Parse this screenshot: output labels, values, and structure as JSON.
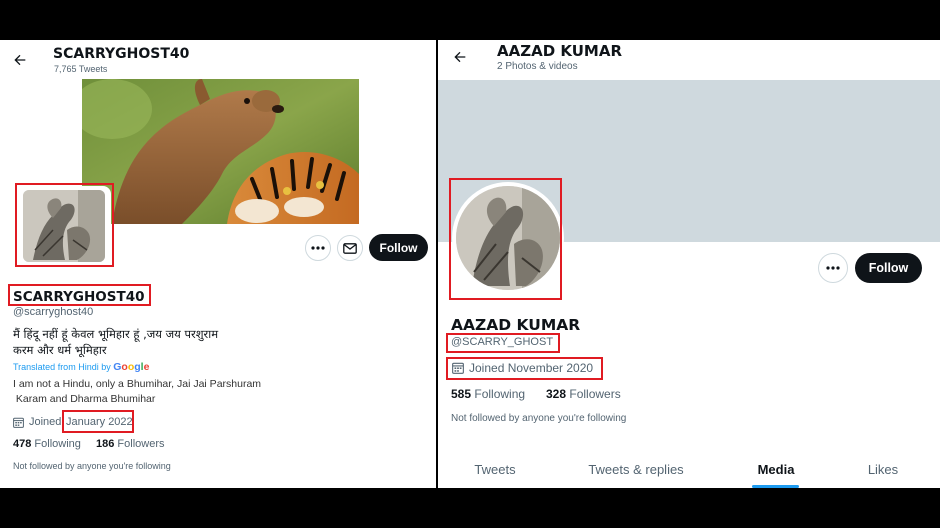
{
  "left": {
    "header": {
      "title": "SCARRYGHOST40",
      "subtitle": "7,765 Tweets"
    },
    "profile": {
      "display_name": "SCARRYGHOST40",
      "handle": "@scarryghost40",
      "bio_line1": "मैं हिंदू नहीं हूं केवल भूमिहार हूं ,जय जय परशुराम",
      "bio_line2": "करम और धर्म भूमिहार",
      "translated_label": "Translated from Hindi by",
      "google_letters": [
        "G",
        "o",
        "o",
        "g",
        "l",
        "e"
      ],
      "translation_line1": "I am not a Hindu, only a Bhumihar, Jai Jai Parshuram",
      "translation_line2": " Karam and Dharma Bhumihar",
      "joined_prefix": "Joined",
      "joined_date": "January 2022",
      "following_count": "478",
      "following_label": "Following",
      "followers_count": "186",
      "followers_label": "Followers",
      "not_followed": "Not followed by anyone you're following"
    },
    "follow_label": "Follow"
  },
  "right": {
    "header": {
      "title": "AAZAD KUMAR",
      "subtitle": "2 Photos & videos"
    },
    "profile": {
      "display_name": "AAZAD KUMAR",
      "handle": "@SCARRY_GHOST",
      "joined_text": "Joined November 2020",
      "following_count": "585",
      "following_label": "Following",
      "followers_count": "328",
      "followers_label": "Followers",
      "not_followed": "Not followed by anyone you're following"
    },
    "follow_label": "Follow",
    "tabs": [
      "Tweets",
      "Tweets & replies",
      "Media",
      "Likes"
    ],
    "active_tab": "Media"
  },
  "colors": {
    "highlight_box": "#e01b22",
    "follow_button": "#0f1419",
    "link_blue": "#1d9bf0",
    "banner_grey": "#cfd9de",
    "google": [
      "#4285F4",
      "#EA4335",
      "#FBBC05",
      "#4285F4",
      "#34A853",
      "#EA4335"
    ]
  },
  "icons": [
    "back-arrow-icon",
    "more-icon",
    "mail-icon",
    "calendar-icon"
  ]
}
